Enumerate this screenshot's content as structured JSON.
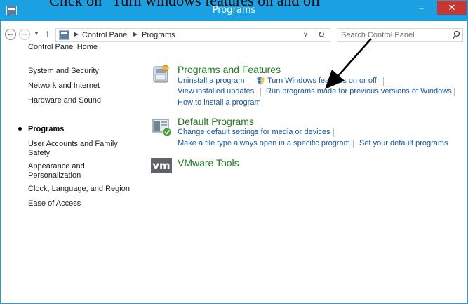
{
  "caption": "Click on \"Turn windows features on and off\"",
  "window": {
    "title": "Programs",
    "minimize": "–",
    "close": "✕"
  },
  "address": {
    "breadcrumbs": [
      "Control Panel",
      "Programs"
    ],
    "search_placeholder": "Search Control Panel"
  },
  "leftnav": {
    "items": [
      {
        "label": "Control Panel Home"
      },
      {
        "label": "System and Security"
      },
      {
        "label": "Network and Internet"
      },
      {
        "label": "Hardware and Sound"
      },
      {
        "label": "Programs"
      },
      {
        "label": "User Accounts and Family"
      },
      {
        "label": "Safety"
      },
      {
        "label": "Appearance and"
      },
      {
        "label": "Personalization"
      },
      {
        "label": "Clock, Language, and Region"
      },
      {
        "label": "Ease of Access"
      }
    ]
  },
  "main": {
    "programs_features": {
      "title": "Programs and Features",
      "links": [
        "Uninstall a program",
        "Turn Windows features on or off",
        "View installed updates",
        "Run programs made for previous versions of Windows",
        "How to install a program"
      ]
    },
    "default_programs": {
      "title": "Default Programs",
      "links": [
        "Change default settings for media or devices",
        "Make a file type always open in a specific program",
        "Set your default programs"
      ]
    },
    "vmware": {
      "title": "VMware Tools",
      "logo": "vm"
    }
  },
  "colors": {
    "titlebar": "#1ba1e2",
    "close_button": "#c7372f",
    "section_title": "#1e7a1e",
    "link": "#1a56b0"
  }
}
